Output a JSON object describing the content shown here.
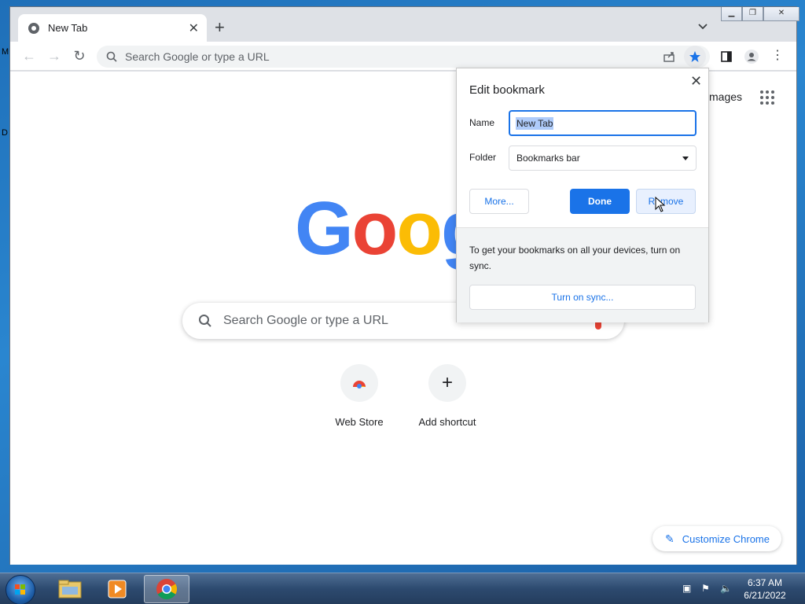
{
  "desktop": {
    "fragments": [
      "M",
      "D"
    ]
  },
  "browser": {
    "tab": {
      "title": "New Tab"
    },
    "toolbar": {
      "omnibox_placeholder": "Search Google or type a URL"
    },
    "window_controls": [
      "minimize",
      "maximize",
      "close"
    ]
  },
  "new_tab_page": {
    "images_link": "mages",
    "logo_text": "Goog",
    "search_placeholder": "Search Google or type a URL",
    "shortcuts": [
      {
        "label": "Web Store"
      },
      {
        "label": "Add shortcut"
      }
    ],
    "customize_label": "Customize Chrome"
  },
  "bookmark_dialog": {
    "title": "Edit bookmark",
    "name_label": "Name",
    "name_value": "New Tab",
    "folder_label": "Folder",
    "folder_value": "Bookmarks bar",
    "more_label": "More...",
    "done_label": "Done",
    "remove_label": "Remove",
    "sync_text": "To get your bookmarks on all your devices, turn on sync.",
    "sync_button": "Turn on sync..."
  },
  "taskbar": {
    "apps": [
      "explorer-icon",
      "media-player-icon",
      "chrome-icon"
    ],
    "active_app": "chrome-icon",
    "clock_time": "6:37 AM",
    "clock_date": "6/21/2022"
  },
  "colors": {
    "accent": "#1a73e8",
    "google_blue": "#4285f4",
    "google_red": "#ea4335",
    "google_yellow": "#fbbc05",
    "google_green": "#34a853"
  }
}
